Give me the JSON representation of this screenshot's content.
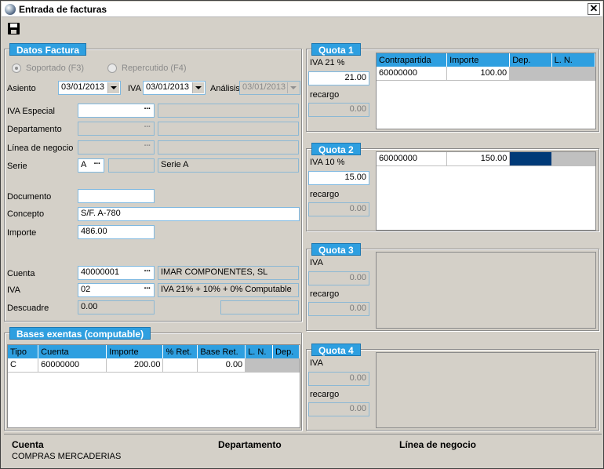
{
  "window": {
    "title": "Entrada de facturas",
    "close_label": "✕"
  },
  "datos": {
    "legend": "Datos Factura",
    "radio_soportado": "Soportado (F3)",
    "radio_repercutido": "Repercutido (F4)",
    "asiento_label": "Asiento",
    "asiento_value": "03/01/2013",
    "iva_label": "IVA",
    "iva_date_value": "03/01/2013",
    "analisis_label": "Análisis",
    "analisis_value": "03/01/2013",
    "iva_especial_label": "IVA Especial",
    "departamento_label": "Departamento",
    "linea_label": "Línea de negocio",
    "serie_label": "Serie",
    "serie_code": "A",
    "serie_name": "Serie A",
    "documento_label": "Documento",
    "documento_value": "",
    "concepto_label": "Concepto",
    "concepto_value": "S/F. A-780",
    "importe_label": "Importe",
    "importe_value": "486.00",
    "cuenta_label": "Cuenta",
    "cuenta_value": "40000001",
    "cuenta_name": "IMAR COMPONENTES, SL",
    "iva2_label": "IVA",
    "iva2_value": "02",
    "iva2_desc": "IVA 21% + 10% + 0% Computable",
    "descuadre_label": "Descuadre",
    "descuadre_value": "0.00"
  },
  "bases": {
    "legend": "Bases exentas  (computable)",
    "columns": [
      "Tipo",
      "Cuenta",
      "Importe",
      "% Ret.",
      "Base Ret.",
      "L. N.",
      "Dep."
    ],
    "rows": [
      {
        "tipo": "C",
        "cuenta": "60000000",
        "importe": "200.00",
        "ret": "",
        "base_ret": "0.00",
        "ln": "",
        "dep": ""
      }
    ]
  },
  "quota1": {
    "legend": "Quota 1",
    "iva_label": "IVA 21 %",
    "iva_value": "21.00",
    "recargo_label": "recargo",
    "recargo_value": "0.00",
    "columns": [
      "Contrapartida",
      "Importe",
      "Dep.",
      "L. N."
    ],
    "rows": [
      {
        "cuenta": "60000000",
        "importe": "100.00"
      }
    ]
  },
  "quota2": {
    "legend": "Quota 2",
    "iva_label": "IVA 10 %",
    "iva_value": "15.00",
    "recargo_label": "recargo",
    "recargo_value": "0.00",
    "rows": [
      {
        "cuenta": "60000000",
        "importe": "150.00"
      }
    ]
  },
  "quota3": {
    "legend": "Quota 3",
    "iva_label": "IVA",
    "iva_value": "0.00",
    "recargo_label": "recargo",
    "recargo_value": "0.00"
  },
  "quota4": {
    "legend": "Quota 4",
    "iva_label": "IVA",
    "iva_value": "0.00",
    "recargo_label": "recargo",
    "recargo_value": "0.00"
  },
  "status": {
    "cuenta_header": "Cuenta",
    "cuenta_value": "COMPRAS MERCADERIAS",
    "departamento_header": "Departamento",
    "linea_header": "Línea de negocio"
  },
  "colors": {
    "accent": "#2e9fe0",
    "selected_cell": "#003a78",
    "window_bg": "#d4d0c8"
  }
}
